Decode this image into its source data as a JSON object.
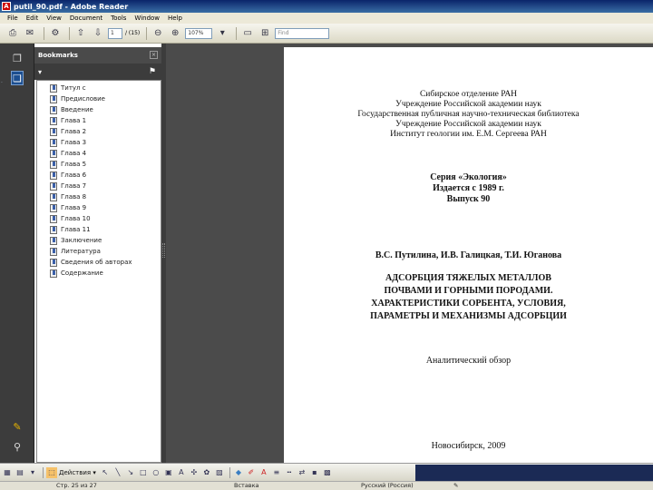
{
  "window": {
    "title": "putil_90.pdf - Adobe Reader",
    "app_icon": "pdf-app-icon"
  },
  "menu": [
    "File",
    "Edit",
    "View",
    "Document",
    "Tools",
    "Window",
    "Help"
  ],
  "toolbar": {
    "page_value": "1",
    "page_total": "/ (15)",
    "zoom_value": "107%",
    "find_placeholder": "Find"
  },
  "bookmarks": {
    "title": "Bookmarks",
    "options_label": "▾",
    "items": [
      "Титул с",
      "Предисловие",
      "Введение",
      "Глава 1",
      "Глава 2",
      "Глава 3",
      "Глава 4",
      "Глава 5",
      "Глава 6",
      "Глава 7",
      "Глава 8",
      "Глава 9",
      "Глава 10",
      "Глава 11",
      "Заключение",
      "Литература",
      "Сведения об авторах",
      "Содержание"
    ]
  },
  "document": {
    "org_lines": [
      "Сибирское отделение РАН",
      "Учреждение Российской академии наук",
      "Государственная публичная научно-техническая библиотека",
      "Учреждение Российской академии наук",
      "Институт геологии им. Е.М. Сергеева РАН"
    ],
    "series_lines": [
      "Серия «Экология»",
      "Издается с 1989 г.",
      "Выпуск 90"
    ],
    "authors": "В.С. Путилина, И.В. Галицкая, Т.И. Юганова",
    "title_lines": [
      "АДСОРБЦИЯ ТЯЖЕЛЫХ МЕТАЛЛОВ",
      "ПОЧВАМИ И ГОРНЫМИ ПОРОДАМИ.",
      "ХАРАКТЕРИСТИКИ СОРБЕНТА, УСЛОВИЯ,",
      "ПАРАМЕТРЫ И МЕХАНИЗМЫ АДСОРБЦИИ"
    ],
    "genre": "Аналитический обзор",
    "city_year": "Новосибирск, 2009"
  },
  "bottom_toolbar": {
    "actions_label": "Действия ▾",
    "status_page": "Стр. 25 из 27",
    "status_lang": "Русский (Россия)",
    "status_mode": "Вставка"
  },
  "colors": {
    "panel_dark": "#3c3c3c",
    "document_bg": "#4b4b4b",
    "title_bar": "#0a246a"
  }
}
